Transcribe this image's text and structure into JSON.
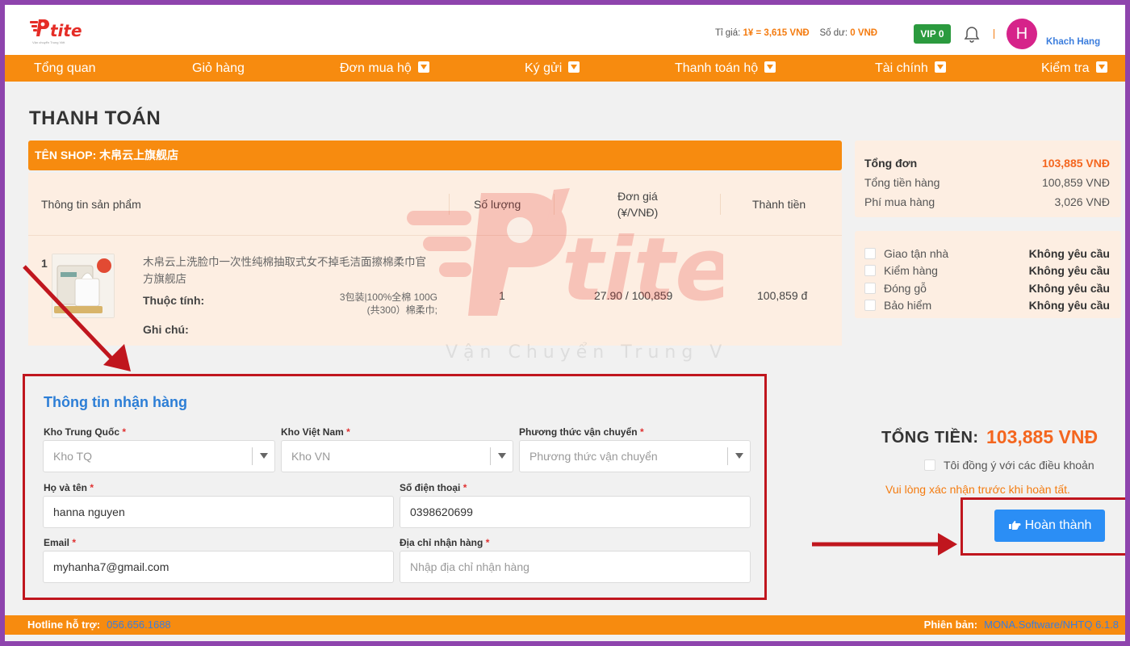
{
  "header": {
    "logo_text": "tite",
    "logo_tagline": "Vận chuyển Trung Việt",
    "rate_label": "Tỉ giá:",
    "rate_value": "1¥ = 3,615 VNĐ",
    "balance_label": "Số dư:",
    "balance_value": "0 VNĐ",
    "vip": "VIP 0",
    "avatar_letter": "H",
    "user_name": "Khach Hang"
  },
  "nav": {
    "items": [
      {
        "label": "Tổng quan"
      },
      {
        "label": "Giỏ hàng"
      },
      {
        "label": "Đơn mua hộ"
      },
      {
        "label": "Ký gửi"
      },
      {
        "label": "Thanh toán hộ"
      },
      {
        "label": "Tài chính"
      },
      {
        "label": "Kiểm tra"
      }
    ]
  },
  "page": {
    "title": "THANH TOÁN",
    "shop_label": "TÊN SHOP: 木帛云上旗舰店"
  },
  "table": {
    "headers": {
      "product": "Thông tin sản phẩm",
      "qty": "Số lượng",
      "price_line1": "Đơn giá",
      "price_line2": "(¥/VNĐ)",
      "total": "Thành tiền"
    },
    "row": {
      "index": "1",
      "name_line1": "木帛云上洗脸巾一次性纯棉抽取式女不掉毛洁面擦棉柔巾官",
      "name_line2": "方旗舰店",
      "attr_label": "Thuộc tính:",
      "attr_line1": "3包装|100%全棉 100G",
      "attr_line2": "(共300）棉柔巾;",
      "note_label": "Ghi chú:",
      "qty": "1",
      "price": "27.90 / 100,859",
      "total": "100,859 đ"
    }
  },
  "watermark": {
    "text": "tite",
    "tagline": "Vận Chuyển Trung Việt"
  },
  "summary": {
    "order_total_label": "Tổng đơn",
    "order_total_value": "103,885 VNĐ",
    "goods_label": "Tổng tiền hàng",
    "goods_value": "100,859 VNĐ",
    "fee_label": "Phí mua hàng",
    "fee_value": "3,026 VNĐ"
  },
  "options": [
    {
      "label": "Giao tận nhà",
      "value": "Không yêu cầu"
    },
    {
      "label": "Kiểm hàng",
      "value": "Không yêu cầu"
    },
    {
      "label": "Đóng gỗ",
      "value": "Không yêu cầu"
    },
    {
      "label": "Bảo hiểm",
      "value": "Không yêu cầu"
    }
  ],
  "form": {
    "title": "Thông tin nhận hàng",
    "kho_tq_label": "Kho Trung Quốc",
    "kho_tq_placeholder": "Kho TQ",
    "kho_vn_label": "Kho Việt Nam",
    "kho_vn_placeholder": "Kho VN",
    "shipping_label": "Phương thức vận chuyển",
    "shipping_placeholder": "Phương thức vận chuyển",
    "name_label": "Họ và tên",
    "name_value": "hanna nguyen",
    "phone_label": "Số điện thoại",
    "phone_value": "0398620699",
    "email_label": "Email",
    "email_value": "myhanha7@gmail.com",
    "address_label": "Địa chỉ nhận hàng",
    "address_placeholder": "Nhập địa chỉ nhận hàng",
    "required_mark": "*"
  },
  "checkout": {
    "total_label": "TỔNG TIỀN:",
    "total_value": "103,885 VNĐ",
    "agree_label": "Tôi đồng ý với các điều khoản",
    "warning": "Vui lòng xác nhận trước khi hoàn tất.",
    "submit_label": "Hoàn thành"
  },
  "footer": {
    "hotline_label": "Hotline hỗ trợ:",
    "hotline_value": "056.656.1688",
    "version_label": "Phiên bản:",
    "version_value": "MONA.Software/NHTQ 6.1.8"
  },
  "colors": {
    "accent": "#f78b0f",
    "brand_red": "#e52d27",
    "annotation_red": "#c0161e",
    "primary_blue": "#2b8ef5",
    "vip_green": "#2b9a3e"
  }
}
